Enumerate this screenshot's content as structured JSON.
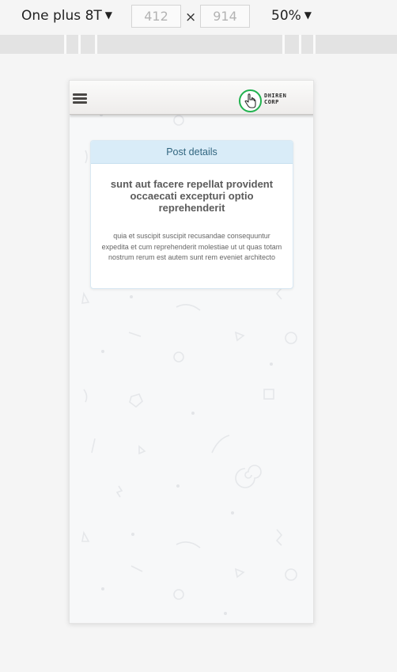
{
  "toolbar": {
    "device": "One plus 8T",
    "width": "412",
    "height": "914",
    "times": "×",
    "zoom": "50%",
    "caret": "▼"
  },
  "app": {
    "logo_line1": "DHIREN",
    "logo_line2": "CORP"
  },
  "card": {
    "header": "Post details",
    "title": "sunt aut facere repellat provident occaecati excepturi optio reprehenderit",
    "body": "quia et suscipit suscipit recusandae consequuntur expedita et cum reprehenderit molestiae ut ut quas totam nostrum rerum est autem sunt rem eveniet architecto"
  },
  "colors": {
    "card_header_bg": "#d9ecf8",
    "card_header_text": "#31657f",
    "logo_ring": "#21b24f",
    "menu_icon": "#4a4745"
  },
  "icons": {
    "menu": "hamburger-icon",
    "logo": "pointing-hand-icon"
  }
}
